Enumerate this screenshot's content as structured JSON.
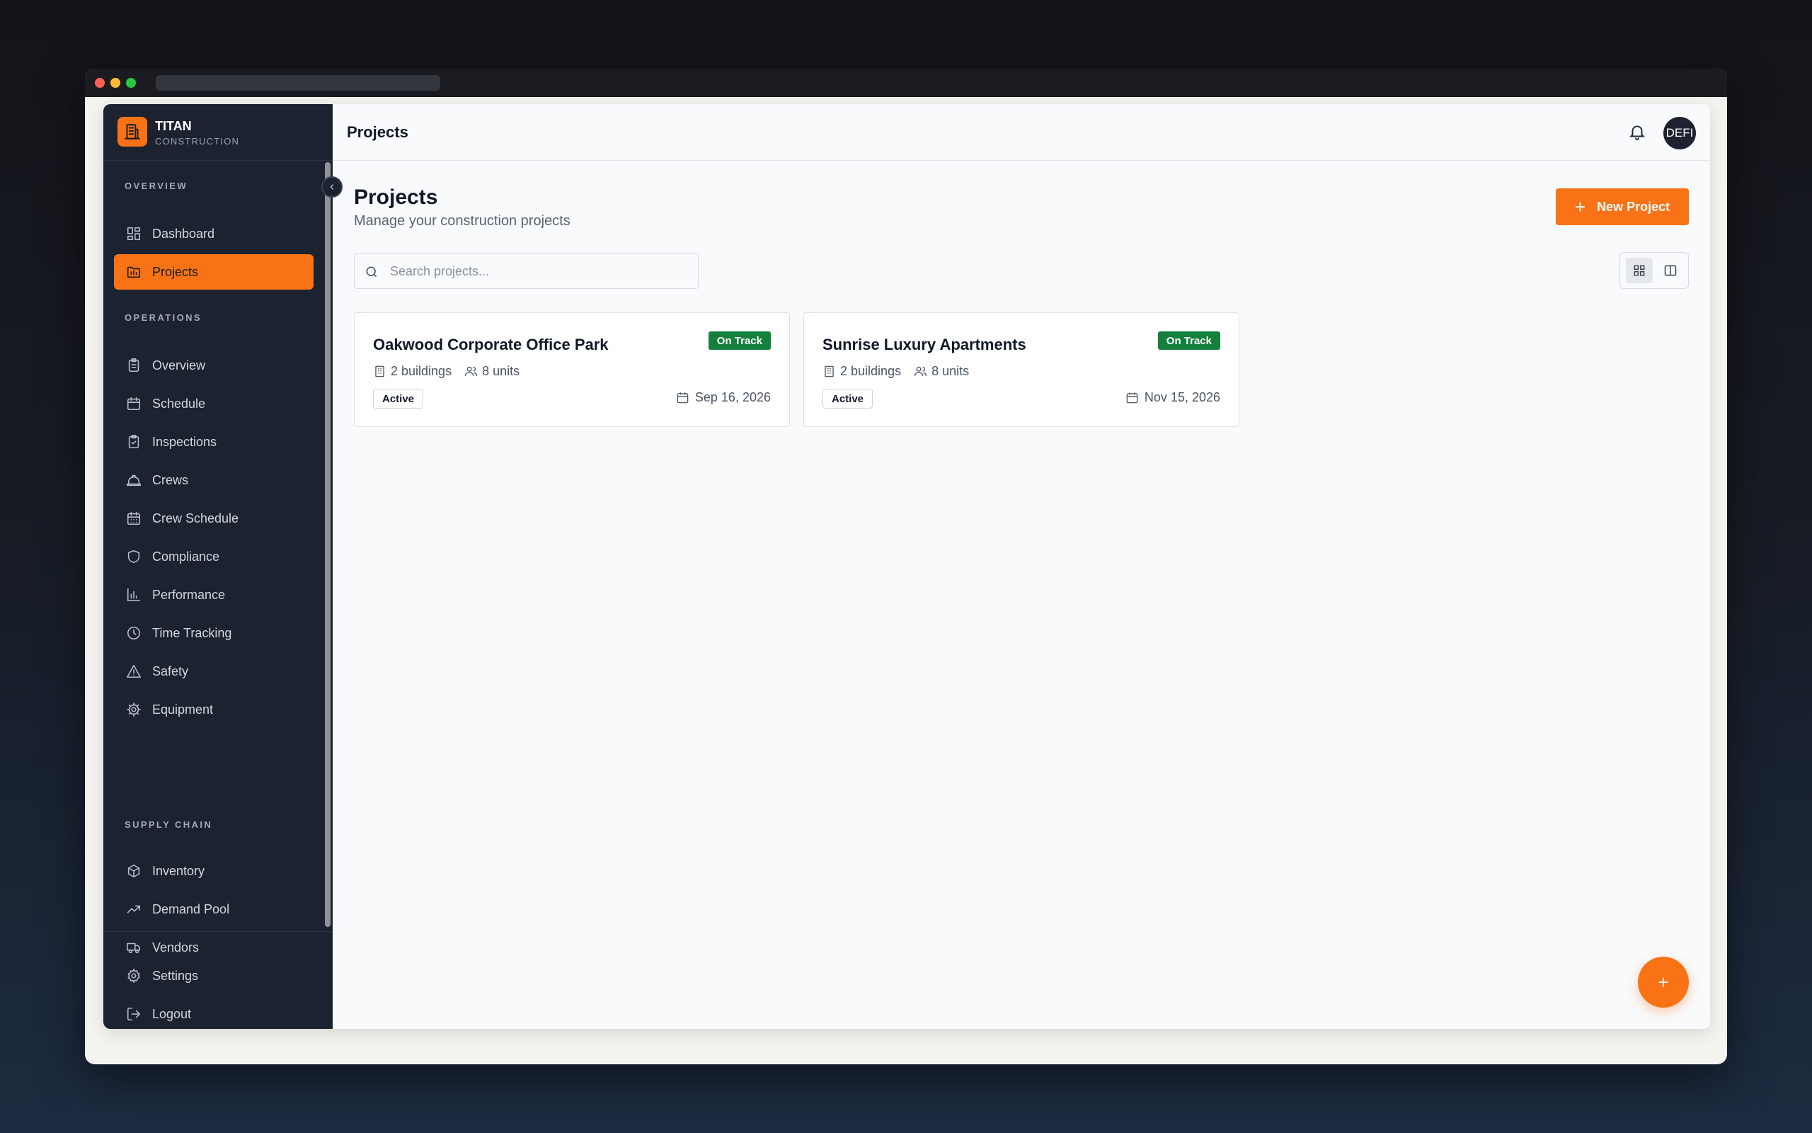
{
  "brand": {
    "name": "TITAN",
    "subtitle": "CONSTRUCTION"
  },
  "sidebar": {
    "sections": [
      "OVERVIEW",
      "OPERATIONS",
      "SUPPLY CHAIN"
    ],
    "items": [
      {
        "label": "Dashboard",
        "icon": "dashboard-icon"
      },
      {
        "label": "Projects",
        "icon": "projects-icon",
        "active": true
      },
      {
        "label": "Overview",
        "icon": "clipboard-icon"
      },
      {
        "label": "Schedule",
        "icon": "calendar-icon"
      },
      {
        "label": "Inspections",
        "icon": "clipboard-check-icon"
      },
      {
        "label": "Crews",
        "icon": "hard-hat-icon"
      },
      {
        "label": "Crew Schedule",
        "icon": "calendar-grid-icon"
      },
      {
        "label": "Compliance",
        "icon": "shield-icon"
      },
      {
        "label": "Performance",
        "icon": "bar-chart-icon"
      },
      {
        "label": "Time Tracking",
        "icon": "clock-icon"
      },
      {
        "label": "Safety",
        "icon": "warning-icon"
      },
      {
        "label": "Equipment",
        "icon": "gear-cog-icon"
      },
      {
        "label": "Inventory",
        "icon": "package-icon"
      },
      {
        "label": "Demand Pool",
        "icon": "trending-up-icon"
      },
      {
        "label": "Vendors",
        "icon": "truck-icon"
      }
    ],
    "footer": [
      {
        "label": "Settings",
        "icon": "settings-icon"
      },
      {
        "label": "Logout",
        "icon": "logout-icon"
      }
    ]
  },
  "topbar": {
    "title": "Projects",
    "avatar_text": "DEFI"
  },
  "main": {
    "title": "Projects",
    "subtitle": "Manage your construction projects",
    "new_button": "New Project",
    "search_placeholder": "Search projects...",
    "fab_label": "+"
  },
  "projects": [
    {
      "name": "Oakwood Corporate Office Park",
      "status": "On Track",
      "buildings": "2 buildings",
      "units": "8 units",
      "state": "Active",
      "date": "Sep 16, 2026"
    },
    {
      "name": "Sunrise Luxury Apartments",
      "status": "On Track",
      "buildings": "2 buildings",
      "units": "8 units",
      "state": "Active",
      "date": "Nov 15, 2026"
    }
  ],
  "colors": {
    "accent": "#f97316",
    "sidebar": "#1d2230",
    "success": "#15803d"
  }
}
